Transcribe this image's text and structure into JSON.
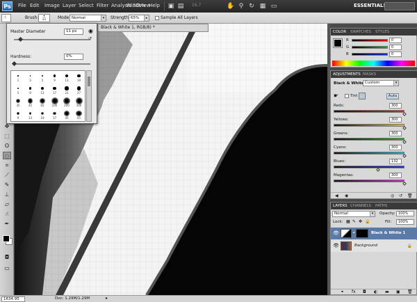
{
  "menubar": {
    "app_icon": "Ps",
    "items": [
      "File",
      "Edit",
      "Image",
      "Layer",
      "Select",
      "Filter",
      "Analysis",
      "3D",
      "View",
      "Window",
      "Help"
    ],
    "zoom_display": "16.7",
    "workspace": "ESSENTIALS"
  },
  "options": {
    "brush_label": "Brush:",
    "brush_size": "11",
    "mode_label": "Mode:",
    "mode_value": "Normal",
    "strength_label": "Strength:",
    "strength_value": "65%",
    "sample_all_layers": "Sample All Layers"
  },
  "brush_popup": {
    "diameter_label": "Master Diameter",
    "diameter_value": "11 px",
    "hardness_label": "Hardness:",
    "hardness_value": "0%",
    "diameter_level": 0.08,
    "hardness_level": 0.0,
    "brushes": [
      {
        "size": 1,
        "label": "1"
      },
      {
        "size": 3,
        "label": "3"
      },
      {
        "size": 5,
        "label": "5"
      },
      {
        "size": 9,
        "label": "9"
      },
      {
        "size": 13,
        "label": "13"
      },
      {
        "size": 19,
        "label": "19"
      },
      {
        "size": 5,
        "label": "5"
      },
      {
        "size": 9,
        "label": "9"
      },
      {
        "size": 13,
        "label": "13"
      },
      {
        "size": 17,
        "label": "17"
      },
      {
        "size": 21,
        "label": "21"
      },
      {
        "size": 27,
        "label": "27"
      },
      {
        "size": 35,
        "label": "35"
      },
      {
        "size": 45,
        "label": "45"
      },
      {
        "size": 65,
        "label": "65"
      },
      {
        "size": 100,
        "label": "100"
      },
      {
        "size": 200,
        "label": "200"
      },
      {
        "size": 300,
        "label": "300"
      },
      {
        "size": 9,
        "label": "9"
      },
      {
        "size": 13,
        "label": "13"
      },
      {
        "size": 19,
        "label": "19"
      },
      {
        "size": 17,
        "label": "17"
      },
      {
        "size": 45,
        "label": "45"
      },
      {
        "size": 65,
        "label": "65"
      }
    ]
  },
  "document": {
    "tab_title": "Black & White 1, RGB/8) *",
    "zoom": "1634.95",
    "doc_info": "Doc: 1.29M/1.29M"
  },
  "color_panel": {
    "tabs": [
      "COLOR",
      "SWATCHES",
      "STYLES"
    ],
    "channels": [
      {
        "label": "R",
        "value": "0",
        "gradient": "#e01010"
      },
      {
        "label": "G",
        "value": "0",
        "gradient": "#10b010"
      },
      {
        "label": "B",
        "value": "0",
        "gradient": "#1030e0"
      }
    ]
  },
  "adjustments_panel": {
    "tabs": [
      "ADJUSTMENTS",
      "MASKS"
    ],
    "title": "Black & White",
    "preset": "Custom",
    "tint_label": "Tint",
    "auto_label": "Auto",
    "sliders": [
      {
        "label": "Reds:",
        "value": "300",
        "level": 1.0,
        "gradient": "#cc2a2a"
      },
      {
        "label": "Yellows:",
        "value": "300",
        "level": 1.0,
        "gradient": "#d6c21e"
      },
      {
        "label": "Greens:",
        "value": "300",
        "level": 1.0,
        "gradient": "#2ca42c"
      },
      {
        "label": "Cyans:",
        "value": "300",
        "level": 1.0,
        "gradient": "#1bb5c8"
      },
      {
        "label": "Blues:",
        "value": "132",
        "level": 0.62,
        "gradient": "#2233cc"
      },
      {
        "label": "Magentas:",
        "value": "300",
        "level": 1.0,
        "gradient": "#c62cc6"
      }
    ]
  },
  "layers_panel": {
    "tabs": [
      "LAYERS",
      "CHANNELS",
      "PATHS"
    ],
    "blend_mode": "Normal",
    "opacity_label": "Opacity:",
    "opacity_value": "100%",
    "lock_label": "Lock:",
    "fill_label": "Fill:",
    "fill_value": "100%",
    "layers": [
      {
        "name": "Black & White 1",
        "selected": true
      },
      {
        "name": "Background",
        "selected": false
      }
    ]
  }
}
